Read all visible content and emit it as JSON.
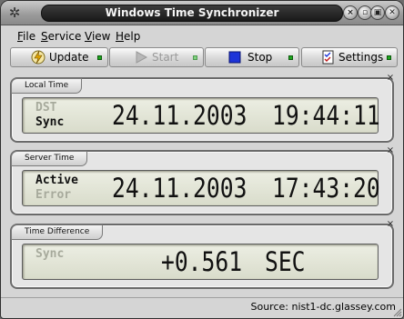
{
  "window": {
    "title": "Windows Time Synchronizer"
  },
  "menu": [
    {
      "key": "F",
      "rest": "ile"
    },
    {
      "key": "S",
      "rest": "ervice"
    },
    {
      "key": "V",
      "rest": "iew"
    },
    {
      "key": "H",
      "rest": "elp"
    }
  ],
  "toolbar": {
    "update_label": "Update",
    "start_label": "Start",
    "stop_label": "Stop",
    "settings_label": "Settings"
  },
  "panels": {
    "local": {
      "title": "Local Time",
      "status_top": "DST",
      "status_bottom": "Sync",
      "date": "24.11.2003",
      "time": "19:44:11"
    },
    "server": {
      "title": "Server Time",
      "status_top": "Active",
      "status_bottom": "Error",
      "date": "24.11.2003",
      "time": "17:43:20"
    },
    "difference": {
      "title": "Time Difference",
      "status_top": "Sync",
      "value": "+0.561",
      "unit": "SEC"
    }
  },
  "status": {
    "source": "Source: nist1-dc.glassey.com"
  },
  "icons": {
    "system": "gear-icon",
    "update": "lightning-clock-icon",
    "start": "play-icon",
    "stop": "stop-square-icon",
    "settings": "checklist-icon"
  },
  "colors": {
    "led_active": "#1fa61f",
    "lcd_bg": "#e2e5d4"
  }
}
